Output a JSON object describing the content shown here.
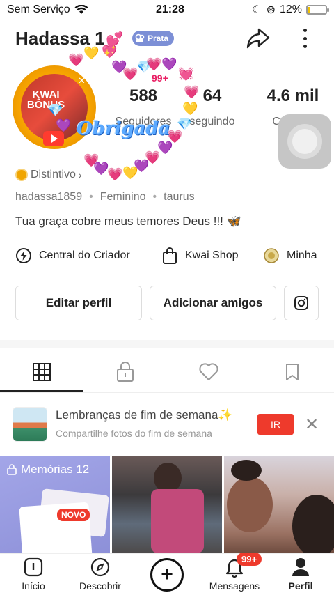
{
  "status_bar": {
    "carrier": "Sem Serviço",
    "time": "21:28",
    "battery": "12%",
    "battery_level": 0.12
  },
  "profile": {
    "username": "Hadassa 1",
    "tier_badge": "Prata",
    "avatar_text": "KWAI BÔNUS",
    "overlay_text": "Obrigada",
    "overlay_count": "99+",
    "stats": [
      {
        "value": "588",
        "label": "Seguidores"
      },
      {
        "value": "64",
        "label": "seguindo"
      },
      {
        "value": "4.6 mil",
        "label": "Curtidas"
      }
    ],
    "distintivo": "Distintivo",
    "handle": "hadassa1859",
    "gender": "Feminino",
    "sign": "taurus",
    "bio": "Tua graça cobre meus temores Deus !!!",
    "bio_emoji": "🦋"
  },
  "shortcuts": [
    {
      "label": "Central do Criador",
      "icon": "lightning-icon"
    },
    {
      "label": "Kwai Shop",
      "icon": "shopping-bag-icon"
    },
    {
      "label": "Minha",
      "icon": "coin-medal-icon"
    }
  ],
  "buttons": {
    "edit": "Editar perfil",
    "add_friends": "Adicionar amigos",
    "instagram_icon": "instagram-icon"
  },
  "tabs": [
    {
      "icon": "grid-icon",
      "active": true
    },
    {
      "icon": "lock-icon",
      "active": false
    },
    {
      "icon": "heart-outline-icon",
      "active": false
    },
    {
      "icon": "bookmark-icon",
      "active": false
    }
  ],
  "promo": {
    "title": "Lembranças de fim de semana✨",
    "subtitle": "Compartilhe fotos do fim de semana",
    "action": "IR"
  },
  "grid": {
    "memories_label": "Memórias 12",
    "new_badge": "NOVO"
  },
  "bottom_nav": {
    "items": [
      {
        "label": "Início",
        "icon": "home-icon"
      },
      {
        "label": "Descobrir",
        "icon": "compass-icon"
      },
      {
        "label": "",
        "icon": "plus-circle-icon"
      },
      {
        "label": "Mensagens",
        "icon": "bell-icon",
        "badge": "99+"
      },
      {
        "label": "Perfil",
        "icon": "person-icon"
      }
    ]
  }
}
